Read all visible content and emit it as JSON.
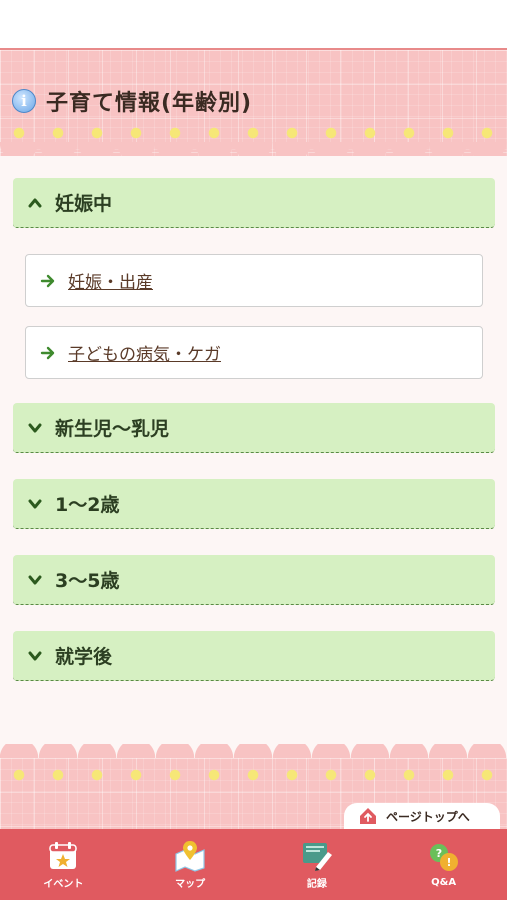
{
  "header": {
    "title": "子育て情報(年齢別)",
    "icon": "info-icon"
  },
  "accordions": [
    {
      "label": "妊娠中",
      "expanded": true,
      "icon": "chevron-up-icon",
      "items": [
        {
          "label": "妊娠・出産"
        },
        {
          "label": "子どもの病気・ケガ"
        }
      ]
    },
    {
      "label": "新生児〜乳児",
      "expanded": false,
      "icon": "chevron-down-icon"
    },
    {
      "label": "1〜2歳",
      "expanded": false,
      "icon": "chevron-down-icon"
    },
    {
      "label": "3〜5歳",
      "expanded": false,
      "icon": "chevron-down-icon"
    },
    {
      "label": "就学後",
      "expanded": false,
      "icon": "chevron-down-icon"
    }
  ],
  "page_top": {
    "label": "ページトップへ"
  },
  "bottom_nav": [
    {
      "label": "イベント",
      "icon": "calendar-star-icon"
    },
    {
      "label": "マップ",
      "icon": "map-pin-icon"
    },
    {
      "label": "記録",
      "icon": "notebook-pen-icon"
    },
    {
      "label": "Q&A",
      "icon": "qa-bubbles-icon"
    }
  ],
  "colors": {
    "header_pink": "#f8c3c3",
    "accordion_green": "#d6f0c2",
    "nav_red": "#e05a60",
    "link_arrow_green": "#3f8a2e"
  }
}
